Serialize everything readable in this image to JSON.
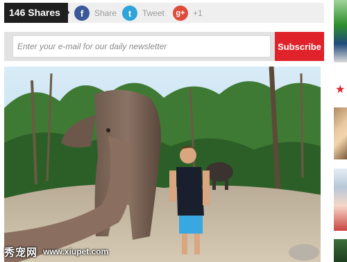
{
  "share_bar": {
    "count_label": "146 Shares",
    "items": [
      {
        "network": "facebook",
        "icon": "facebook-icon",
        "glyph": "f",
        "label": "Share",
        "color": "#3b5998"
      },
      {
        "network": "twitter",
        "icon": "twitter-icon",
        "glyph": "t",
        "label": "Tweet",
        "color": "#2fa4d8"
      },
      {
        "network": "googleplus",
        "icon": "google-plus-icon",
        "glyph": "g+",
        "label": "+1",
        "color": "#dd4b39"
      }
    ]
  },
  "newsletter": {
    "placeholder": "Enter your e-mail for our daily newsletter",
    "value": "",
    "subscribe_label": "Subscribe",
    "accent_color": "#e0232a"
  },
  "photo": {
    "description_icon": "elephant-selfie-photo"
  },
  "sidebar": {
    "star_icon": "star-icon"
  },
  "watermark": {
    "site_cn": "秀宠网",
    "url": "www.xiupet.com"
  }
}
